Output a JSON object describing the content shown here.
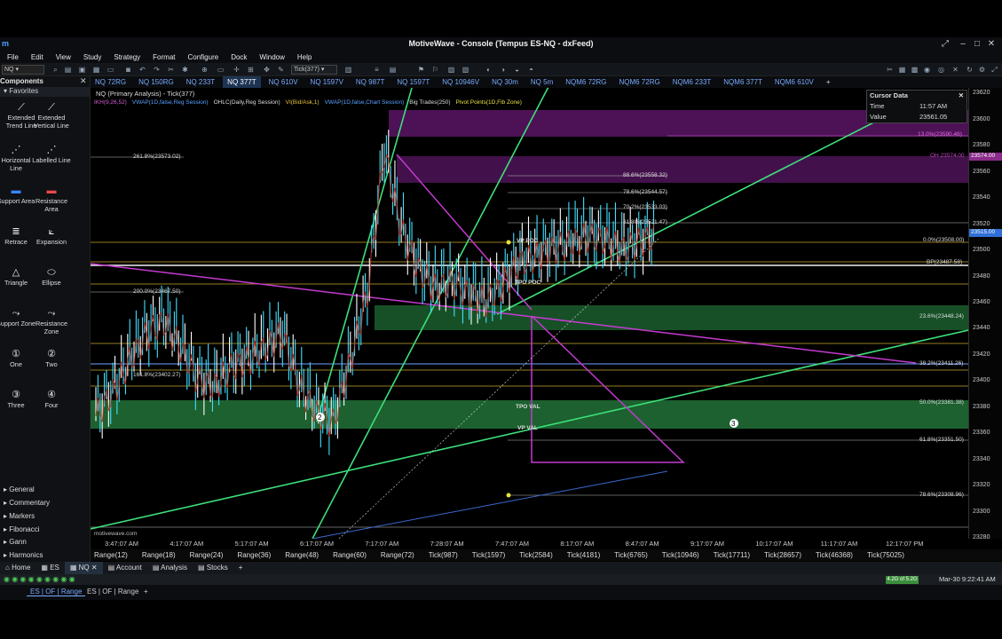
{
  "app": {
    "title": "MotiveWave - Console (Tempus ES-NQ - dxFeed)",
    "logo": "motivewave-logo"
  },
  "window_controls": [
    "restore-icon",
    "minimize-icon",
    "maximize-icon",
    "close-icon"
  ],
  "menu": [
    "File",
    "Edit",
    "View",
    "Study",
    "Strategy",
    "Format",
    "Configure",
    "Dock",
    "Window",
    "Help"
  ],
  "toolbar": {
    "bar_size": "Tick(377)"
  },
  "sidebar": {
    "title": "Components",
    "favorites_label": "Favorites",
    "tools": [
      {
        "label": "Extended Trend Line",
        "icon": "trend-line-icon"
      },
      {
        "label": "Extended Vertical Line",
        "icon": "vertical-line-icon"
      },
      {
        "label": "Horizontal Line",
        "icon": "horizontal-line-icon"
      },
      {
        "label": "Labelled Line",
        "icon": "labelled-line-icon"
      },
      {
        "label": "Support Area",
        "icon": "support-area-icon"
      },
      {
        "label": "Resistance Area",
        "icon": "resistance-area-icon"
      },
      {
        "label": "Retrace",
        "icon": "retrace-icon"
      },
      {
        "label": "Expansion",
        "icon": "expansion-icon"
      },
      {
        "label": "Triangle",
        "icon": "triangle-icon"
      },
      {
        "label": "Ellipse",
        "icon": "ellipse-icon"
      },
      {
        "label": "Support Zone",
        "icon": "support-zone-icon"
      },
      {
        "label": "Resistance Zone",
        "icon": "resistance-zone-icon"
      },
      {
        "label": "One",
        "icon": "marker-one-icon"
      },
      {
        "label": "Two",
        "icon": "marker-two-icon"
      },
      {
        "label": "Three",
        "icon": "marker-three-icon"
      },
      {
        "label": "Four",
        "icon": "marker-four-icon"
      }
    ],
    "categories": [
      "General",
      "Commentary",
      "Markers",
      "Fibonacci",
      "Gann",
      "Harmonics"
    ]
  },
  "chart_tabs": [
    "NQ 72RG",
    "NQ 150RG",
    "NQ 233T",
    "NQ 377T",
    "NQ 610V",
    "NQ 1597V",
    "NQ 987T",
    "NQ 1597T",
    "NQ 10946V",
    "NQ 30m",
    "NQ 5m",
    "NQM6 72RG",
    "NQM6 72RG",
    "NQM6 233T",
    "NQM6 377T",
    "NQM6 610V"
  ],
  "active_chart_tab": "NQ 377T",
  "chart": {
    "instrument_title": "NQ (Primary Analysis) - Tick(377)",
    "studies": [
      {
        "label": "IKH(9,26,52)",
        "color": "#d45bd4"
      },
      {
        "label": "VWAP(1D,false,Reg Session)",
        "color": "#5aa0ff"
      },
      {
        "label": "OHLC(Daily,Reg Session)",
        "color": "#dddddd"
      },
      {
        "label": "VI(Bid/Ask,1)",
        "color": "#e8c040"
      },
      {
        "label": "VWAP(1D,false,Chart Session)",
        "color": "#5aa0ff"
      },
      {
        "label": "Big Trades(250)",
        "color": "#dddddd"
      },
      {
        "label": "Pivot Points(1D,Fib Zone)",
        "color": "#e8e040"
      }
    ],
    "watermark": "motivewave.com",
    "fib_labels": [
      "261.8%(23573.02)",
      "88.6%(23558.32)",
      "78.6%(23544.57)",
      "70.2%(23533.03)",
      "61.8%(23521.47)",
      "13.0%(23590.46)",
      "0.0%(23508.00)",
      "BP(23487.58)",
      "200.0%(23467.50)",
      "23.6%(23448.24)",
      "38.2%(23411.26)",
      "161.8%(23402.27)",
      "50.0%(23381.38)",
      "61.8%(23351.50)",
      "78.6%(23308.96)",
      "OH 23574.00"
    ],
    "zone_labels": {
      "vp_poc": "VP POC",
      "tpo_poc": "TPO POC",
      "tpo_val": "TPO VAL",
      "vp_val": "VP VAL"
    },
    "markers": [
      "2",
      "3"
    ]
  },
  "chart_data": {
    "type": "candlestick",
    "title": "NQ (Primary Analysis) - Tick(377)",
    "ylim": [
      23280,
      23625
    ],
    "y_ticks": [
      23620,
      23600,
      23580,
      23560,
      23540,
      23520,
      23500,
      23480,
      23460,
      23440,
      23420,
      23400,
      23380,
      23360,
      23340,
      23320,
      23300,
      23280
    ],
    "x_ticks": [
      "3:47:07 AM",
      "4:17:07 AM",
      "5:17:07 AM",
      "6:17:07 AM",
      "7:17:07 AM",
      "7:28:07 AM",
      "7:47:07 AM",
      "8:17:07 AM",
      "8:47:07 AM",
      "9:17:07 AM",
      "10:17:07 AM",
      "11:17:07 AM",
      "12:17:07 PM"
    ],
    "price_markers": [
      "23574.00",
      "23515.00"
    ],
    "close_estimates": [
      23378,
      23395,
      23420,
      23440,
      23450,
      23430,
      23405,
      23400,
      23415,
      23420,
      23430,
      23440,
      23400,
      23380,
      23372,
      23420,
      23470,
      23580,
      23520,
      23490,
      23475,
      23480,
      23470,
      23465,
      23478,
      23495,
      23500,
      23505,
      23510,
      23515,
      23512,
      23505,
      23510,
      23515
    ]
  },
  "cursor_data": {
    "title": "Cursor Data",
    "rows": [
      {
        "k": "Time",
        "v": "11:57 AM"
      },
      {
        "k": "Value",
        "v": "23561.05"
      }
    ]
  },
  "range_buttons": [
    "Range(12)",
    "Range(18)",
    "Range(24)",
    "Range(36)",
    "Range(48)",
    "Range(60)",
    "Range(72)",
    "Tick(987)",
    "Tick(1597)",
    "Tick(2584)",
    "Tick(4181)",
    "Tick(6765)",
    "Tick(10946)",
    "Tick(17711)",
    "Tick(28657)",
    "Tick(46368)",
    "Tick(75025)"
  ],
  "bottom_tabs": [
    "Home",
    "ES",
    "NQ",
    "Account",
    "Analysis",
    "Stocks"
  ],
  "active_bottom_tab": "NQ",
  "status": {
    "memory": "4.2G of 5.2G",
    "clock": "Mar-30 9:22:41 AM"
  },
  "workspace_tabs": [
    "ES | OF | Range",
    "ES | OF | Range"
  ]
}
